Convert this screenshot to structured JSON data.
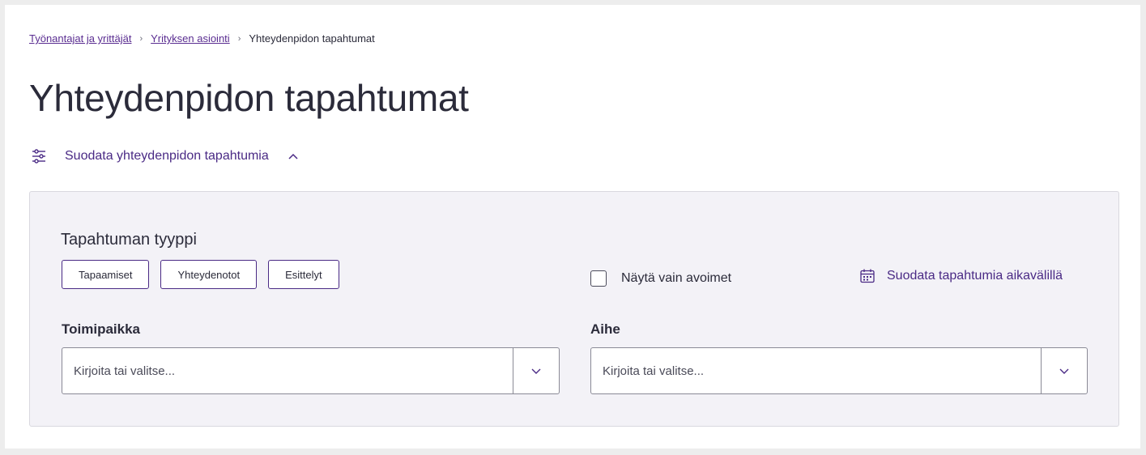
{
  "breadcrumb": {
    "items": [
      {
        "label": "Työnantajat ja yrittäjät"
      },
      {
        "label": "Yrityksen asiointi"
      }
    ],
    "separator": "›",
    "current": "Yhteydenpidon tapahtumat"
  },
  "page": {
    "title": "Yhteydenpidon tapahtumat"
  },
  "filter_toggle": {
    "label": "Suodata yhteydenpidon tapahtumia",
    "icon": "sliders-icon",
    "expanded": true
  },
  "filters": {
    "event_type": {
      "title": "Tapahtuman tyyppi",
      "chips": [
        "Tapaamiset",
        "Yhteydenotot",
        "Esittelyt"
      ]
    },
    "only_open": {
      "label": "Näytä vain avoimet",
      "checked": false
    },
    "date_range": {
      "label": "Suodata tapahtumia aikavälillä",
      "icon": "calendar-icon"
    },
    "location": {
      "label": "Toimipaikka",
      "placeholder": "Kirjoita tai valitse..."
    },
    "topic": {
      "label": "Aihe",
      "placeholder": "Kirjoita tai valitse..."
    }
  },
  "colors": {
    "accent": "#4a2a85",
    "link": "#5a2d91",
    "panel_bg": "#f3f2f7",
    "page_bg": "#ededed"
  }
}
